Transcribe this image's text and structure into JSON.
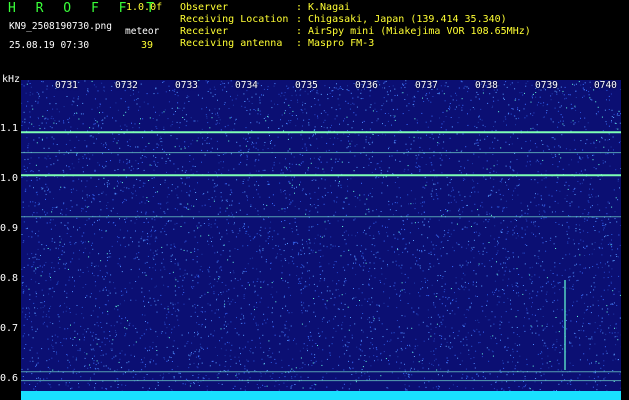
{
  "header": {
    "app_title": "H R O F F T",
    "version": "1.0.0f",
    "filename": "KN9_2508190730.png",
    "meteor_label": "meteor",
    "datetime": "25.08.19 07:30",
    "meteor_count": "39"
  },
  "meta": [
    {
      "key": "Observer",
      "value": "K.Nagai"
    },
    {
      "key": "Receiving Location",
      "value": "Chigasaki, Japan (139.414 35.340)"
    },
    {
      "key": "Receiver",
      "value": "AirSpy mini (Miakejima VOR 108.65MHz)"
    },
    {
      "key": "Receiving antenna",
      "value": "Maspro FM-3"
    }
  ],
  "spectrogram": {
    "y_unit": "kHz",
    "x_ticks": [
      "0731",
      "0732",
      "0733",
      "0734",
      "0735",
      "0736",
      "0737",
      "0738",
      "0739",
      "0740"
    ],
    "y_ticks": [
      "1.1",
      "1.0",
      "0.9",
      "0.8",
      "0.7",
      "0.6"
    ],
    "y_range_khz": [
      0.58,
      1.21
    ],
    "carrier_lines_khz": [
      1.104,
      1.063,
      1.017,
      0.933,
      0.619,
      0.601
    ],
    "colors": {
      "background": "#0b0f73",
      "noise": "#3a6cff",
      "signal": "#7dffb4",
      "baseline": "#19e0ff"
    }
  }
}
